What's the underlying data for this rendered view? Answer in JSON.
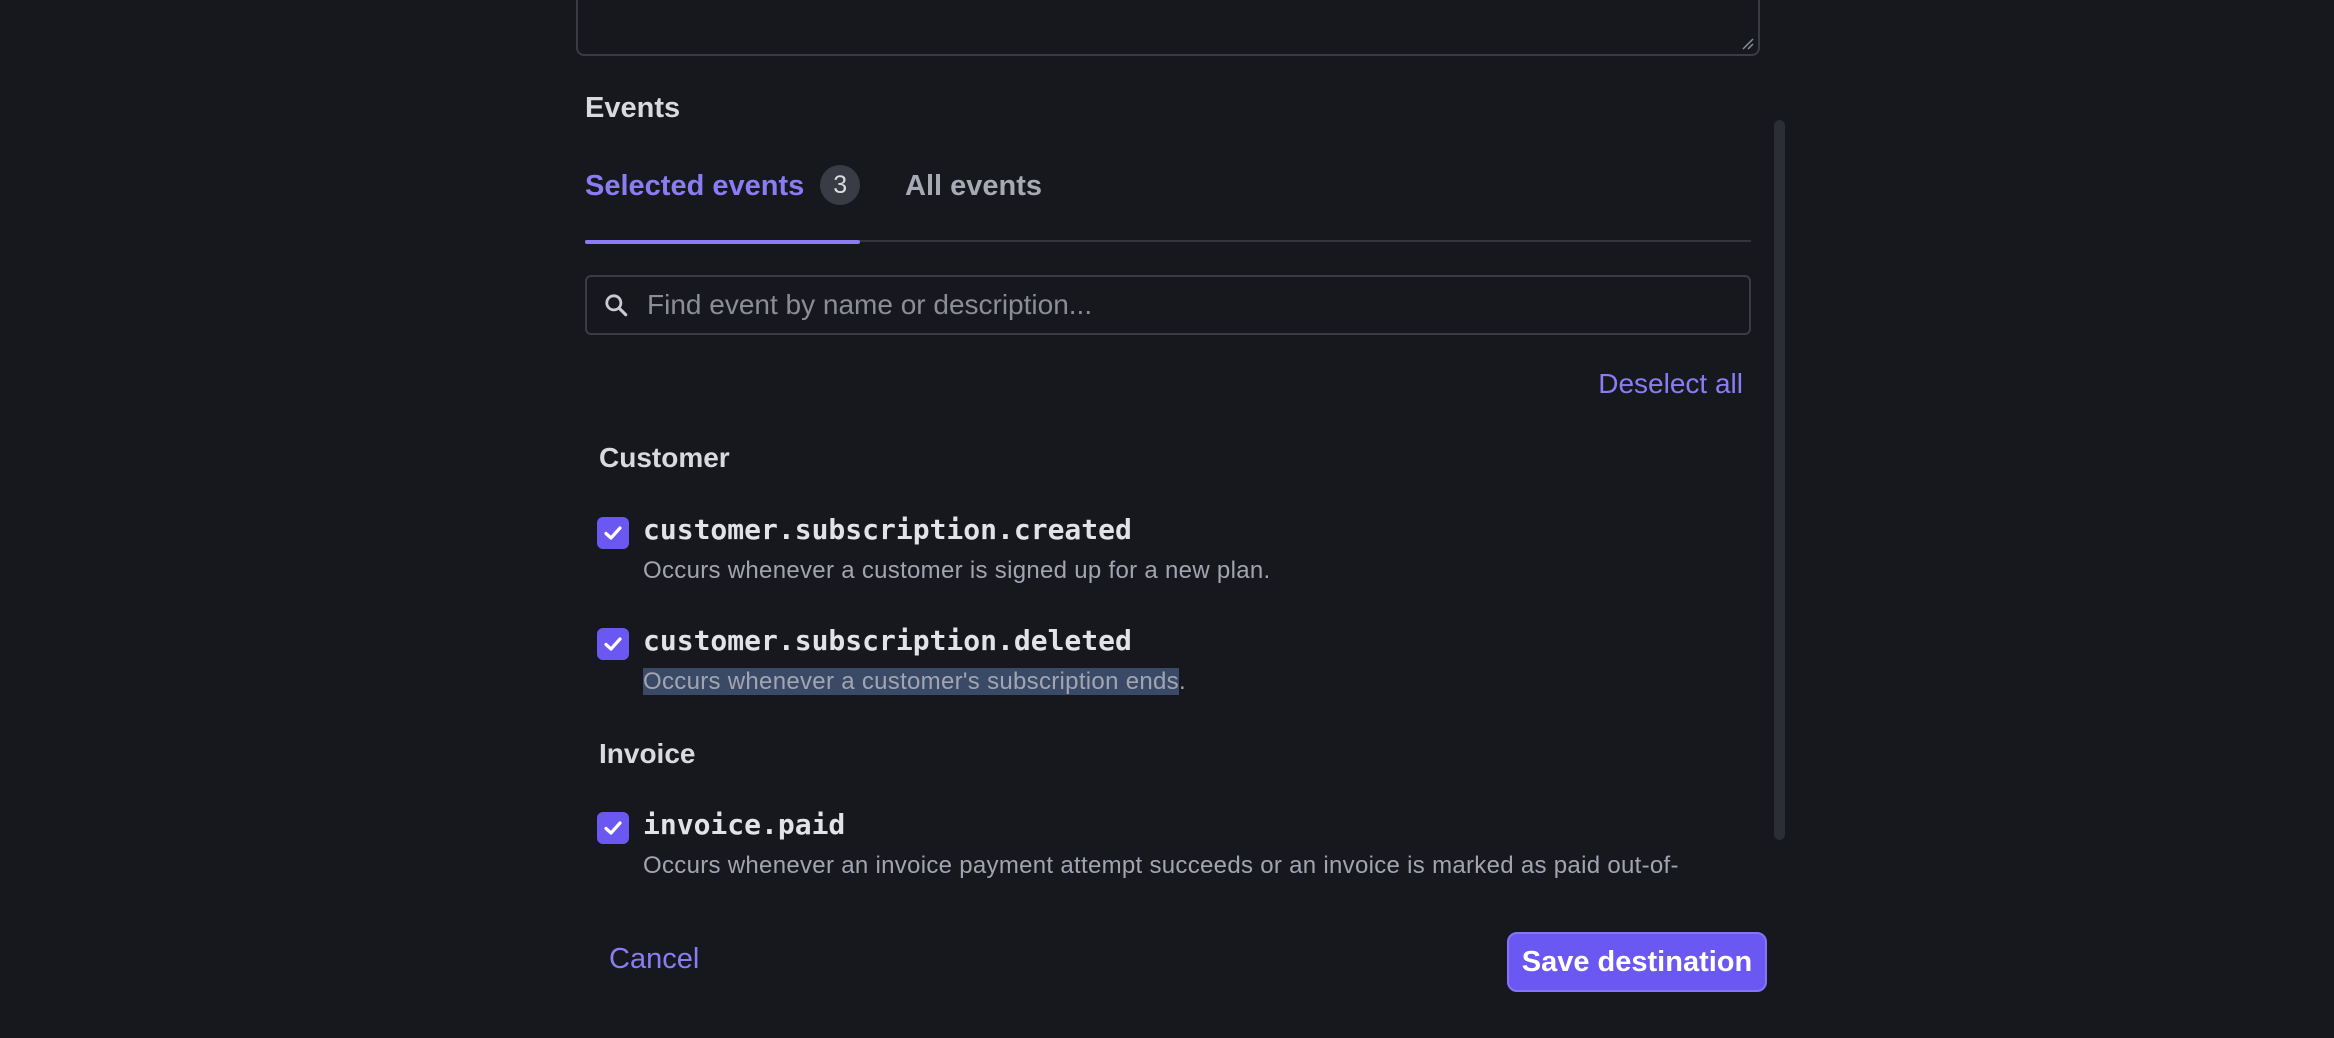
{
  "events_section": {
    "label": "Events"
  },
  "tabs": [
    {
      "label": "Selected events",
      "count": "3",
      "selected": true
    },
    {
      "label": "All events",
      "selected": false
    }
  ],
  "search": {
    "placeholder": "Find event by name or description...",
    "value": "",
    "icon": "search-icon"
  },
  "deselect_all_label": "Deselect all",
  "groups": [
    {
      "title": "Customer",
      "events": [
        {
          "name": "customer.subscription.created",
          "description": "Occurs whenever a customer is signed up for a new plan.",
          "checked": true
        },
        {
          "name": "customer.subscription.deleted",
          "description_highlighted": "Occurs whenever a customer's subscription ends",
          "description_rest": ".",
          "checked": true
        }
      ]
    },
    {
      "title": "Invoice",
      "events": [
        {
          "name": "invoice.paid",
          "description": "Occurs whenever an invoice payment attempt succeeds or an invoice is marked as paid out-of-",
          "checked": true
        }
      ]
    }
  ],
  "footer": {
    "cancel_label": "Cancel",
    "save_label": "Save destination"
  },
  "colors": {
    "background": "#17181d",
    "accent": "#8b7cf6",
    "button": "#6b57f1",
    "text_selection": "#3a4a66"
  }
}
